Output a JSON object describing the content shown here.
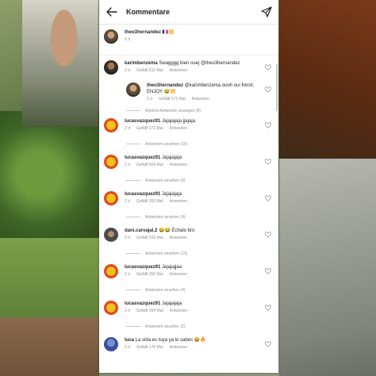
{
  "header": {
    "title": "Kommentare",
    "back_icon": "arrow-left-icon",
    "send_icon": "paper-plane-icon"
  },
  "caption": {
    "username": "theo3hernandez",
    "text": "🇫🇷💥",
    "time": "2 d"
  },
  "comments": [
    {
      "username": "karimbenzema",
      "text": "Swagggg bien ouej @theo3hernandez",
      "time": "2 d",
      "likes": "Gefällt 512 Mal",
      "reply": "Antworten"
    },
    {
      "username": "theo3hernandez",
      "text": "@karimbenzema oooh oui frérot, ENJOY 😂💥",
      "time": "2 d",
      "likes": "Gefällt 272 Mal",
      "reply": "Antworten"
    },
    {
      "username": "lucasvazquez91",
      "text": "Jajajajaja jjajaja",
      "time": "2 d",
      "likes": "Gefällt 372 Mal",
      "reply": "Antworten"
    },
    {
      "username": "lucasvazquez91",
      "text": "Jajajajaja",
      "time": "2 d",
      "likes": "Gefällt 504 Mal",
      "reply": "Antworten"
    },
    {
      "username": "lucasvazquez91",
      "text": "Jajajajaja",
      "time": "2 d",
      "likes": "Gefällt 363 Mal",
      "reply": "Antworten"
    },
    {
      "username": "dani.carvajal.2",
      "text": "😂😂 Échalo bro",
      "time": "2 d",
      "likes": "Gefällt 333 Mal",
      "reply": "Antworten"
    },
    {
      "username": "lucasvazquez91",
      "text": "Jajajajjaa",
      "time": "2 d",
      "likes": "Gefällt 350 Mal",
      "reply": "Antworten"
    },
    {
      "username": "lucasvazquez91",
      "text": "Jajajajaja",
      "time": "2 d",
      "likes": "Gefällt 354 Mal",
      "reply": "Antworten"
    },
    {
      "username": "luca",
      "text": "La vida es tuya ya lo sabes 😂🔥",
      "time": "2 d",
      "likes": "Gefällt 176 Mal",
      "reply": "Antworten"
    }
  ],
  "reply_toggles": {
    "more_replies": "Weitere Antworten anzeigen (9)",
    "r1": "Antworten ansehen (10)",
    "r2": "Antworten ansehen (9)",
    "r3": "Antworten ansehen (9)",
    "r4": "Antworten ansehen (10)",
    "r5": "Antworten ansehen (4)",
    "r6": "Antworten ansehen (2)"
  }
}
